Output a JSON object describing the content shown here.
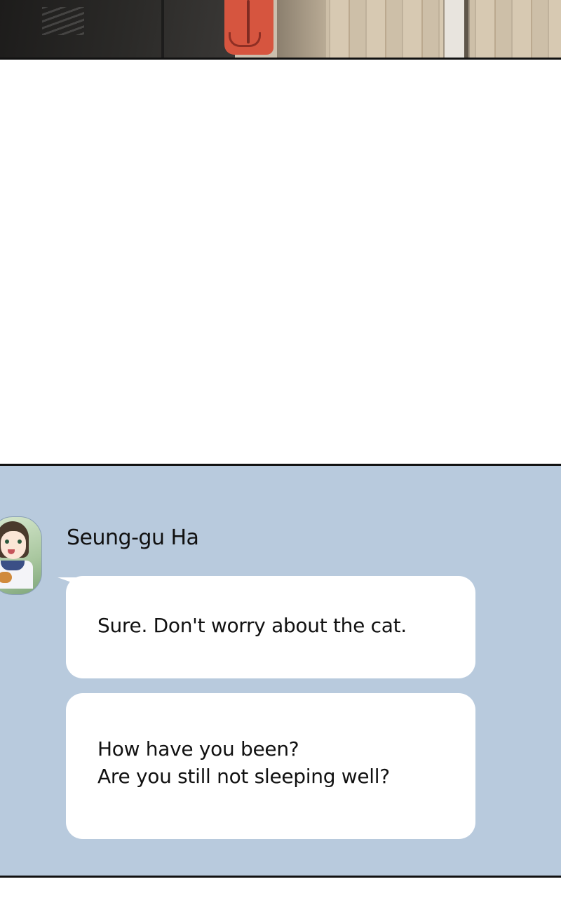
{
  "chat": {
    "sender_name": "Seung-gu Ha",
    "messages": [
      {
        "text": "Sure. Don't worry about the cat."
      },
      {
        "text": "How have you been?\nAre you still not sleeping well?"
      }
    ]
  },
  "colors": {
    "chat_background": "#b8cadd",
    "bubble": "#ffffff",
    "panel_border": "#111111"
  },
  "icons": {
    "avatar": "profile-photo-girl-with-cat"
  }
}
